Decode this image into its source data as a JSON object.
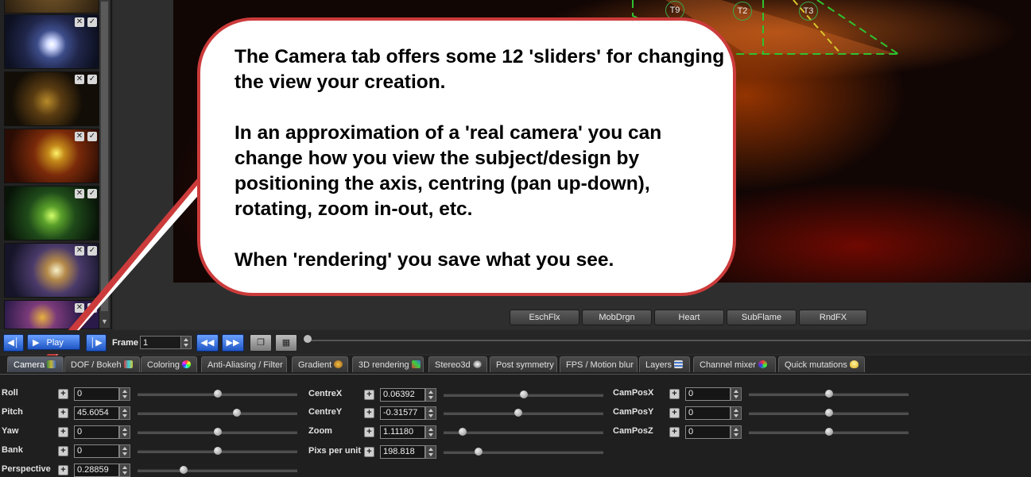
{
  "callout": {
    "paragraphs": [
      "The Camera tab offers some 12 'sliders' for changing the view your creation.",
      "In an approximation of a 'real camera' you can change how you view the subject/design by positioning the axis, centring (pan up-down), rotating, zoom in-out, etc.",
      "When 'rendering' you save what you see."
    ]
  },
  "preview": {
    "triangle_labels": [
      "T9",
      "T2",
      "T3"
    ]
  },
  "thumbnails": {
    "remove_glyph": "✕",
    "check_glyph": "✓",
    "count": 6,
    "scroll_arrow": "▼"
  },
  "variation_buttons": [
    "EschFlx",
    "MobDrgn",
    "Heart",
    "SubFlame",
    "RndFX"
  ],
  "playback": {
    "play_label": "Play",
    "frame_label": "Frame",
    "frame_value": "1",
    "icons": [
      "prev-icon",
      "play-icon",
      "next-icon",
      "rewind-icon",
      "fast-forward-icon",
      "copy-icon",
      "film-icon"
    ]
  },
  "tabs": [
    {
      "label": "Camera",
      "active": true
    },
    {
      "label": "DOF / Bokeh",
      "active": false
    },
    {
      "label": "Coloring",
      "active": false
    },
    {
      "label": "Anti-Aliasing / Filter",
      "active": false
    },
    {
      "label": "Gradient",
      "active": false
    },
    {
      "label": "3D rendering",
      "active": false
    },
    {
      "label": "Stereo3d",
      "active": false
    },
    {
      "label": "Post symmetry",
      "active": false
    },
    {
      "label": "FPS / Motion blur",
      "active": false
    },
    {
      "label": "Layers",
      "active": false
    },
    {
      "label": "Channel mixer",
      "active": false
    },
    {
      "label": "Quick mutations",
      "active": false
    }
  ],
  "camera_params": {
    "col1": [
      {
        "label": "Roll",
        "value": "0",
        "slider_fraction": 0.5
      },
      {
        "label": "Pitch",
        "value": "45.6054",
        "slider_fraction": 0.62
      },
      {
        "label": "Yaw",
        "value": "0",
        "slider_fraction": 0.5
      },
      {
        "label": "Bank",
        "value": "0",
        "slider_fraction": 0.5
      },
      {
        "label": "Perspective",
        "value": "0.28859",
        "slider_fraction": 0.29
      }
    ],
    "col2": [
      {
        "label": "CentreX",
        "value": "0.06392",
        "slider_fraction": 0.5
      },
      {
        "label": "CentreY",
        "value": "-0.31577",
        "slider_fraction": 0.47
      },
      {
        "label": "Zoom",
        "value": "1.11180",
        "slider_fraction": 0.12
      },
      {
        "label": "Pixs per unit",
        "value": "198.818",
        "slider_fraction": 0.22
      }
    ],
    "col3": [
      {
        "label": "CamPosX",
        "value": "0",
        "slider_fraction": 0.5
      },
      {
        "label": "CamPosY",
        "value": "0",
        "slider_fraction": 0.5
      },
      {
        "label": "CamPosZ",
        "value": "0",
        "slider_fraction": 0.5
      }
    ]
  },
  "colors": {
    "callout_border": "#cc3b3b",
    "triangle_green": "#2fc12f",
    "triangle_yellow": "#d9c82b",
    "play_blue": "#2f67d8"
  }
}
